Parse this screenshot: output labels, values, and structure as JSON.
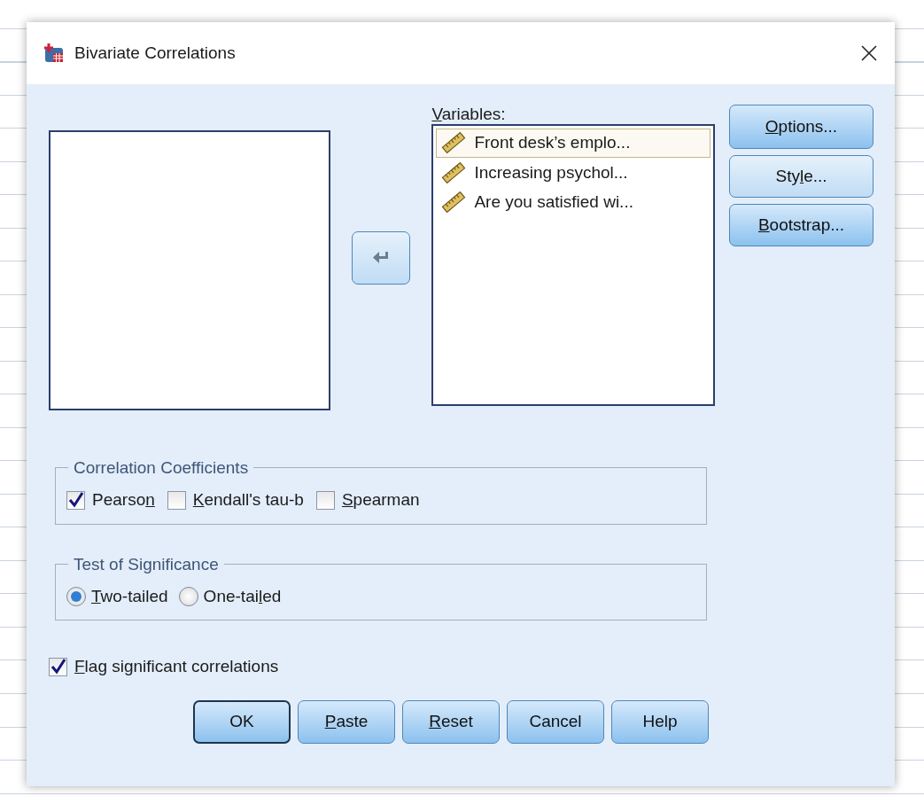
{
  "window": {
    "title": "Bivariate Correlations"
  },
  "variables": {
    "label": {
      "key": "V",
      "post": "ariables:"
    },
    "items": [
      {
        "name": "Front desk’s emplo...",
        "selected": true
      },
      {
        "name": "Increasing psychol...",
        "selected": false
      },
      {
        "name": "Are you satisfied wi...",
        "selected": false
      }
    ]
  },
  "side_buttons": [
    {
      "label": {
        "key": "O",
        "post": "ptions..."
      }
    },
    {
      "label": {
        "pre": "Sty",
        "key": "l",
        "post": "e..."
      }
    },
    {
      "label": {
        "key": "B",
        "post": "ootstrap..."
      }
    }
  ],
  "coefficients": {
    "title": "Correlation Coefficients",
    "options": [
      {
        "label": {
          "pre": "Pearso",
          "key": "n"
        },
        "checked": true
      },
      {
        "label": {
          "key": "K",
          "post": "endall's tau-b"
        },
        "checked": false
      },
      {
        "label": {
          "key": "S",
          "post": "pearman"
        },
        "checked": false
      }
    ]
  },
  "significance": {
    "title": "Test of Significance",
    "options": [
      {
        "label": {
          "key": "T",
          "post": "wo-tailed"
        },
        "selected": true
      },
      {
        "label": {
          "pre": "One-tai",
          "key": "l",
          "post": "ed"
        },
        "selected": false
      }
    ]
  },
  "flag": {
    "label": {
      "key": "F",
      "post": "lag significant correlations"
    },
    "checked": true
  },
  "buttons": [
    {
      "label": {
        "pre": "OK"
      },
      "default": true
    },
    {
      "label": {
        "key": "P",
        "post": "aste"
      },
      "default": false
    },
    {
      "label": {
        "key": "R",
        "post": "eset"
      },
      "default": false
    },
    {
      "label": {
        "pre": "Cancel"
      },
      "default": false
    },
    {
      "label": {
        "pre": "Help"
      },
      "default": false
    }
  ]
}
